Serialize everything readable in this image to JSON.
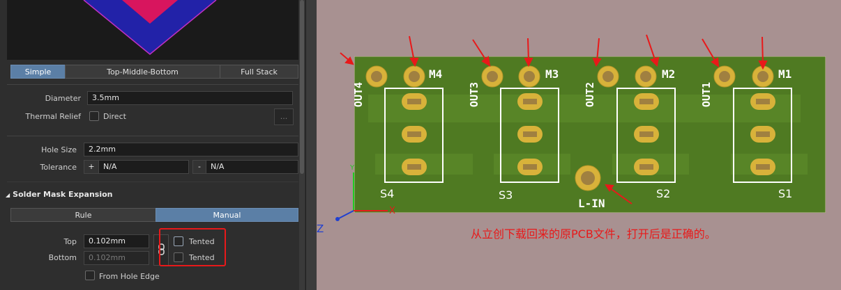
{
  "stack_tabs": {
    "simple": "Simple",
    "tmb": "Top-Middle-Bottom",
    "full": "Full Stack"
  },
  "pad": {
    "diameter_label": "Diameter",
    "diameter_value": "3.5mm",
    "thermal_label": "Thermal Relief",
    "thermal_option": "Direct",
    "more_button": "...",
    "hole_size_label": "Hole Size",
    "hole_size_value": "2.2mm",
    "tolerance_label": "Tolerance",
    "tol_plus": "+",
    "tol_plus_value": "N/A",
    "tol_minus": "-",
    "tol_minus_value": "N/A"
  },
  "solder_mask": {
    "section_title": "Solder Mask Expansion",
    "tab_rule": "Rule",
    "tab_manual": "Manual",
    "top_label": "Top",
    "top_value": "0.102mm",
    "bottom_label": "Bottom",
    "bottom_value": "0.102mm",
    "tented_top": "Tented",
    "tented_bottom": "Tented",
    "from_hole_edge": "From Hole Edge"
  },
  "pcb": {
    "outputs": [
      "OUT4",
      "OUT3",
      "OUT2",
      "OUT1"
    ],
    "motors": [
      "M4",
      "M3",
      "M2",
      "M1"
    ],
    "switches": [
      "S4",
      "S3",
      "S2",
      "S1"
    ],
    "input": "L-IN",
    "axis_x": "X",
    "axis_y": "Y",
    "axis_z": "Z"
  },
  "annotation": "从立创下载回来的原PCB文件，打开后是正确的。",
  "colors": {
    "highlight_box": "#e8191a",
    "board": "#4f7a22",
    "pad": "#d8b23a",
    "silkscreen": "#ffffff"
  }
}
